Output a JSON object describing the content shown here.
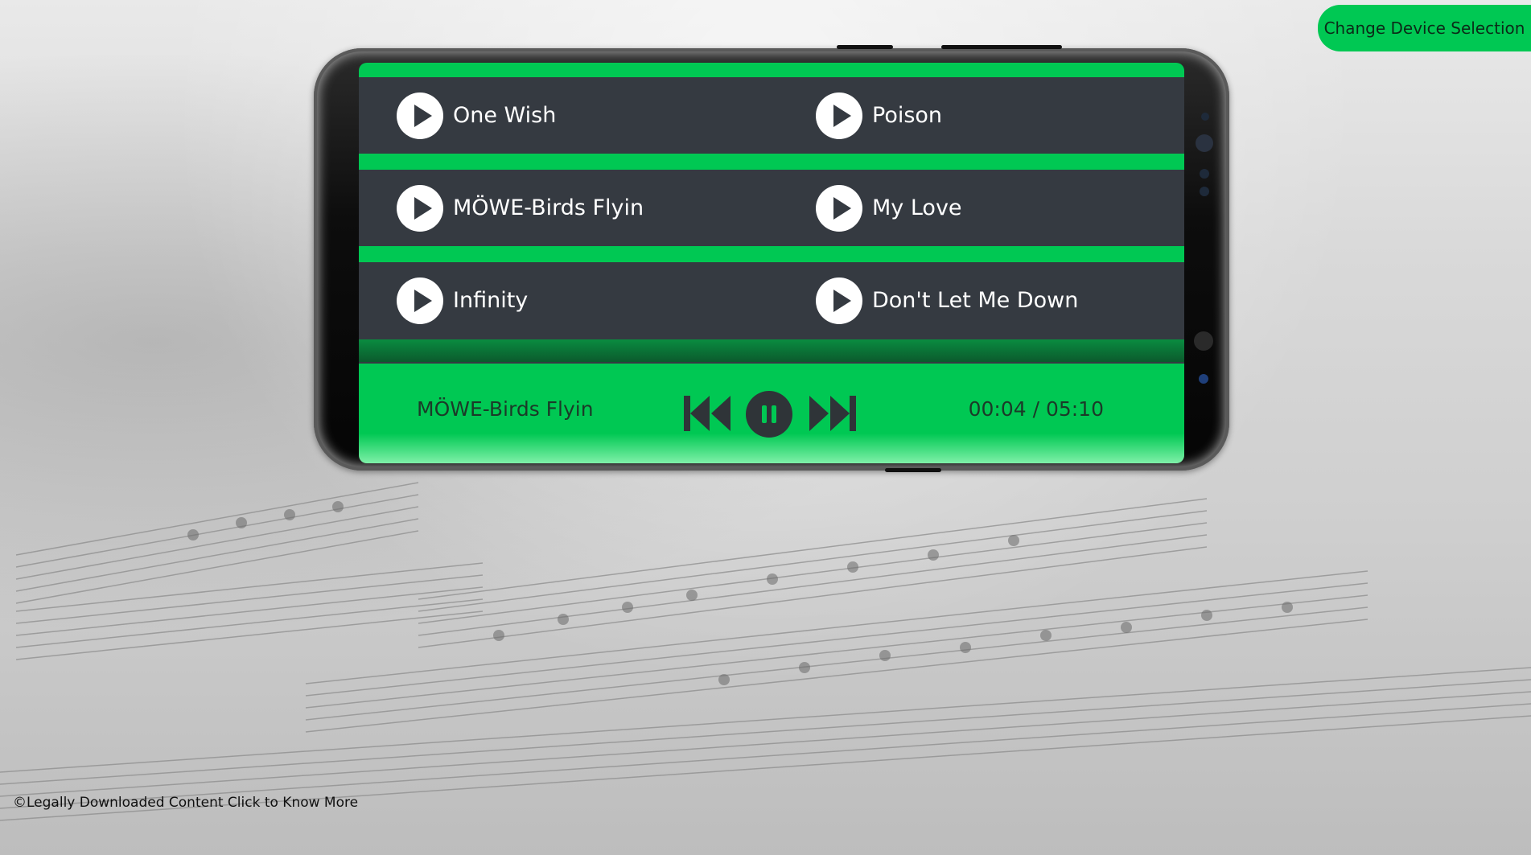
{
  "header": {
    "change_device_label": "Change Device Selection"
  },
  "playlist": [
    {
      "title": "One Wish"
    },
    {
      "title": "Poison"
    },
    {
      "title": "MÖWE-Birds Flyin"
    },
    {
      "title": "My Love"
    },
    {
      "title": "Infinity"
    },
    {
      "title": "Don't Let Me Down"
    }
  ],
  "player": {
    "now_playing": "MÖWE-Birds Flyin",
    "time": "00:04 / 05:10",
    "controls": {
      "previous_icon": "skip-previous-icon",
      "pause_icon": "pause-icon",
      "next_icon": "skip-next-icon"
    }
  },
  "footer": {
    "legal_text": "©Legally Downloaded Content Click to Know More"
  },
  "colors": {
    "accent": "#00c853",
    "panel": "#353a41",
    "text": "#ffffff"
  }
}
